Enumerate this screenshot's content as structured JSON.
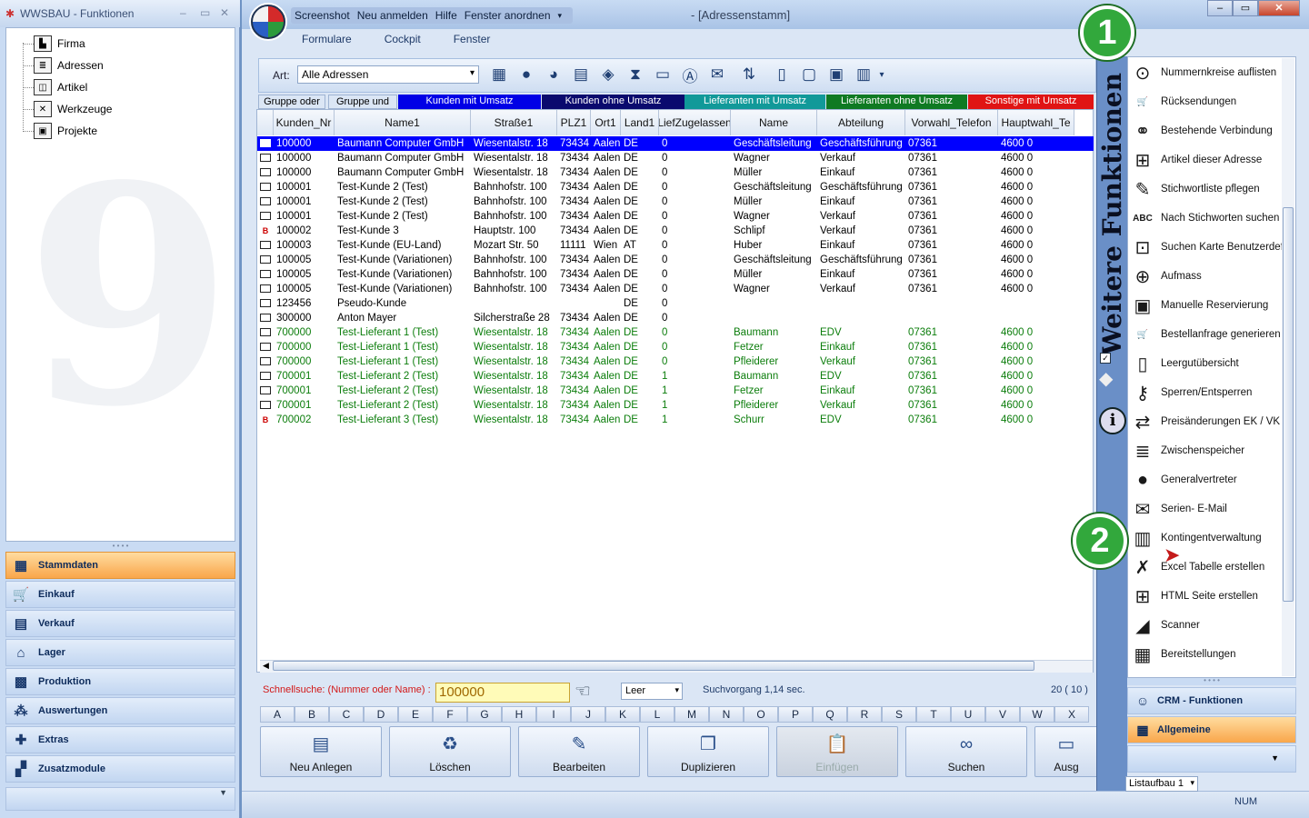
{
  "left_panel": {
    "title": "WWSBAU - Funktionen",
    "tree": [
      {
        "label": "Firma",
        "icon": "factory-icon"
      },
      {
        "label": "Adressen",
        "icon": "address-card-icon"
      },
      {
        "label": "Artikel",
        "icon": "box-icon"
      },
      {
        "label": "Werkzeuge",
        "icon": "tools-icon"
      },
      {
        "label": "Projekte",
        "icon": "project-icon"
      }
    ],
    "nav": [
      {
        "label": "Stammdaten",
        "active": true
      },
      {
        "label": "Einkauf"
      },
      {
        "label": "Verkauf"
      },
      {
        "label": "Lager"
      },
      {
        "label": "Produktion"
      },
      {
        "label": "Auswertungen"
      },
      {
        "label": "Extras"
      },
      {
        "label": "Zusatzmodule"
      }
    ]
  },
  "window": {
    "title": "- [Adressenstamm]",
    "quick_access": [
      "Screenshot",
      "Neu anmelden",
      "Hilfe",
      "Fenster anordnen"
    ],
    "tabs": [
      "Formulare",
      "Cockpit",
      "Fenster"
    ]
  },
  "toolbar": {
    "art_label": "Art:",
    "art_value": "Alle Adressen"
  },
  "groups": [
    {
      "label": "Gruppe oder",
      "bg": "#dbe6f5",
      "fg": "#000000"
    },
    {
      "label": "Gruppe und",
      "bg": "#dbe6f5",
      "fg": "#000000"
    },
    {
      "label": "Kunden mit Umsatz",
      "bg": "#0000e6",
      "fg": "#ffffff"
    },
    {
      "label": "Kunden ohne Umsatz",
      "bg": "#0a0a6e",
      "fg": "#ffffff"
    },
    {
      "label": "Lieferanten mit Umsatz",
      "bg": "#119999",
      "fg": "#ffffff"
    },
    {
      "label": "Lieferanten ohne Umsatz",
      "bg": "#0f7a22",
      "fg": "#ffffff"
    },
    {
      "label": "Sonstige mit Umsatz",
      "bg": "#e01414",
      "fg": "#ffffff"
    }
  ],
  "columns": [
    "",
    "Kunden_Nr",
    "Name1",
    "Straße1",
    "PLZ1",
    "Ort1",
    "Land1",
    "LiefZugelassen",
    "Name",
    "Abteilung",
    "Vorwahl_Telefon",
    "Hauptwahl_Te"
  ],
  "rows": [
    {
      "i": "card",
      "sel": true,
      "c": [
        "100000",
        "Baumann Computer GmbH",
        "Wiesentalstr. 18",
        "73434",
        "Aalen",
        "DE",
        "0",
        "Geschäftsleitung",
        "Geschäftsführung",
        "07361",
        "4600 0"
      ]
    },
    {
      "i": "card",
      "c": [
        "100000",
        "Baumann Computer GmbH",
        "Wiesentalstr. 18",
        "73434",
        "Aalen",
        "DE",
        "0",
        "Wagner",
        "Verkauf",
        "07361",
        "4600 0"
      ]
    },
    {
      "i": "card",
      "c": [
        "100000",
        "Baumann Computer GmbH",
        "Wiesentalstr. 18",
        "73434",
        "Aalen",
        "DE",
        "0",
        "Müller",
        "Einkauf",
        "07361",
        "4600 0"
      ]
    },
    {
      "i": "card",
      "c": [
        "100001",
        "Test-Kunde 2  (Test)",
        "Bahnhofstr. 100",
        "73434",
        "Aalen",
        "DE",
        "0",
        "Geschäftsleitung",
        "Geschäftsführung",
        "07361",
        "4600 0"
      ]
    },
    {
      "i": "card",
      "c": [
        "100001",
        "Test-Kunde 2  (Test)",
        "Bahnhofstr. 100",
        "73434",
        "Aalen",
        "DE",
        "0",
        "Müller",
        "Einkauf",
        "07361",
        "4600 0"
      ]
    },
    {
      "i": "card",
      "c": [
        "100001",
        "Test-Kunde 2  (Test)",
        "Bahnhofstr. 100",
        "73434",
        "Aalen",
        "DE",
        "0",
        "Wagner",
        "Verkauf",
        "07361",
        "4600 0"
      ]
    },
    {
      "i": "B",
      "c": [
        "100002",
        "Test-Kunde 3",
        "Hauptstr. 100",
        "73434",
        "Aalen",
        "DE",
        "0",
        "Schlipf",
        "Verkauf",
        "07361",
        "4600 0"
      ]
    },
    {
      "i": "card",
      "c": [
        "100003",
        "Test-Kunde (EU-Land)",
        "Mozart Str. 50",
        "11111",
        "Wien",
        "AT",
        "0",
        "Huber",
        "Einkauf",
        "07361",
        "4600 0"
      ]
    },
    {
      "i": "card",
      "c": [
        "100005",
        "Test-Kunde (Variationen)",
        "Bahnhofstr. 100",
        "73434",
        "Aalen",
        "DE",
        "0",
        "Geschäftsleitung",
        "Geschäftsführung",
        "07361",
        "4600 0"
      ]
    },
    {
      "i": "card",
      "c": [
        "100005",
        "Test-Kunde (Variationen)",
        "Bahnhofstr. 100",
        "73434",
        "Aalen",
        "DE",
        "0",
        "Müller",
        "Einkauf",
        "07361",
        "4600 0"
      ]
    },
    {
      "i": "card",
      "c": [
        "100005",
        "Test-Kunde (Variationen)",
        "Bahnhofstr. 100",
        "73434",
        "Aalen",
        "DE",
        "0",
        "Wagner",
        "Verkauf",
        "07361",
        "4600 0"
      ]
    },
    {
      "i": "card",
      "c": [
        "123456",
        "Pseudo-Kunde",
        "",
        "",
        "",
        "DE",
        "0",
        "",
        "",
        "",
        ""
      ]
    },
    {
      "i": "card",
      "c": [
        "300000",
        "Anton Mayer",
        "Silcherstraße 28",
        "73434",
        "Aalen",
        "DE",
        "0",
        "",
        "",
        "",
        ""
      ]
    },
    {
      "i": "card",
      "green": true,
      "c": [
        "700000",
        "Test-Lieferant 1  (Test)",
        "Wiesentalstr. 18",
        "73434",
        "Aalen",
        "DE",
        "0",
        "Baumann",
        "EDV",
        "07361",
        "4600 0"
      ]
    },
    {
      "i": "card",
      "green": true,
      "c": [
        "700000",
        "Test-Lieferant 1  (Test)",
        "Wiesentalstr. 18",
        "73434",
        "Aalen",
        "DE",
        "0",
        "Fetzer",
        "Einkauf",
        "07361",
        "4600 0"
      ]
    },
    {
      "i": "card",
      "green": true,
      "c": [
        "700000",
        "Test-Lieferant 1  (Test)",
        "Wiesentalstr. 18",
        "73434",
        "Aalen",
        "DE",
        "0",
        "Pfleiderer",
        "Verkauf",
        "07361",
        "4600 0"
      ]
    },
    {
      "i": "card",
      "green": true,
      "c": [
        "700001",
        "Test-Lieferant 2  (Test)",
        "Wiesentalstr. 18",
        "73434",
        "Aalen",
        "DE",
        "1",
        "Baumann",
        "EDV",
        "07361",
        "4600 0"
      ]
    },
    {
      "i": "card",
      "green": true,
      "c": [
        "700001",
        "Test-Lieferant 2  (Test)",
        "Wiesentalstr. 18",
        "73434",
        "Aalen",
        "DE",
        "1",
        "Fetzer",
        "Einkauf",
        "07361",
        "4600 0"
      ]
    },
    {
      "i": "card",
      "green": true,
      "c": [
        "700001",
        "Test-Lieferant 2  (Test)",
        "Wiesentalstr. 18",
        "73434",
        "Aalen",
        "DE",
        "1",
        "Pfleiderer",
        "Verkauf",
        "07361",
        "4600 0"
      ]
    },
    {
      "i": "B",
      "green": true,
      "c": [
        "700002",
        "Test-Lieferant 3  (Test)",
        "Wiesentalstr. 18",
        "73434",
        "Aalen",
        "DE",
        "1",
        "Schurr",
        "EDV",
        "07361",
        "4600 0"
      ]
    }
  ],
  "search": {
    "label": "Schnellsuche: (Nummer oder Name) :",
    "value": "100000",
    "filter": "Leer",
    "timing": "Suchvorgang 1,14 sec.",
    "count": "20  ( 10 )"
  },
  "letters": [
    "A",
    "B",
    "C",
    "D",
    "E",
    "F",
    "G",
    "H",
    "I",
    "J",
    "K",
    "L",
    "M",
    "N",
    "O",
    "P",
    "Q",
    "R",
    "S",
    "T",
    "U",
    "V",
    "W",
    "X"
  ],
  "buttons": [
    {
      "label": "Neu Anlegen",
      "icon": "document-icon"
    },
    {
      "label": "Löschen",
      "icon": "trash-icon"
    },
    {
      "label": "Bearbeiten",
      "icon": "edit-icon"
    },
    {
      "label": "Duplizieren",
      "icon": "copy-icon"
    },
    {
      "label": "Einfügen",
      "icon": "paste-icon",
      "disabled": true
    },
    {
      "label": "Suchen",
      "icon": "binoculars-icon"
    },
    {
      "label": "Ausg",
      "icon": "printer-icon"
    }
  ],
  "status": {
    "num": "NUM"
  },
  "right_panel": {
    "title": "Weitere Funktionen",
    "items": [
      "Nummernkreise auflisten",
      "Rücksendungen",
      "Bestehende Verbindung",
      "Artikel dieser Adresse",
      "Stichwortliste pflegen",
      "Nach Stichworten suchen",
      "Suchen Karte Benutzerdef.",
      "Aufmass",
      "Manuelle Reservierung",
      "Bestellanfrage generieren",
      "Leergutübersicht",
      "Sperren/Entsperren",
      "Preisänderungen EK / VK",
      "Zwischenspeicher",
      "Generalvertreter",
      "Serien- E-Mail",
      "Kontingentverwaltung",
      "Excel Tabelle erstellen",
      "HTML Seite erstellen",
      "Scanner",
      "Bereitstellungen"
    ],
    "sections": [
      {
        "label": "CRM - Funktionen"
      },
      {
        "label": "Allgemeine",
        "active": true
      }
    ],
    "layout_select": "Listaufbau 1"
  },
  "badges": [
    "1",
    "2"
  ]
}
